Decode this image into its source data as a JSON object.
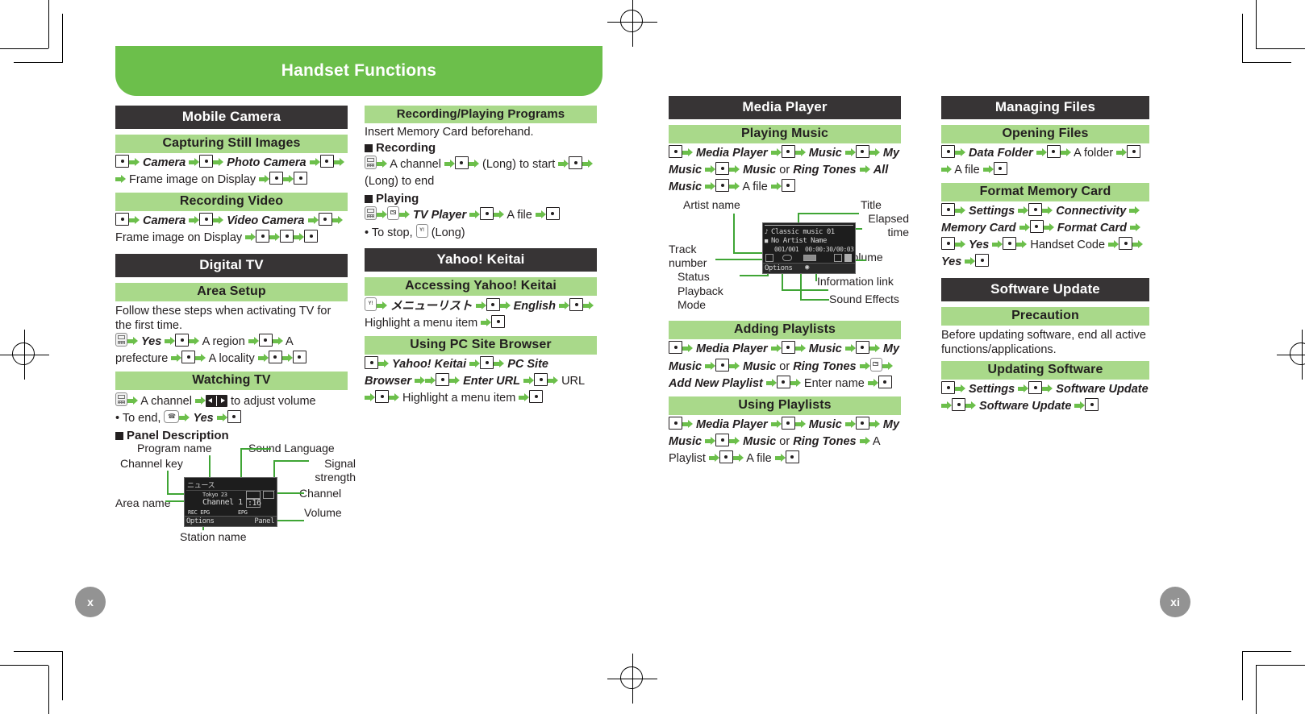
{
  "banner": {
    "title": "Handset Functions"
  },
  "folios": {
    "left": "x",
    "right": "xi"
  },
  "sections": {
    "mobile_camera": {
      "title": "Mobile Camera",
      "capturing": {
        "title": "Capturing Still Images",
        "step_camera": "Camera",
        "step_photo_camera": "Photo Camera",
        "step_frame": "Frame image on Display"
      },
      "recording_video": {
        "title": "Recording Video",
        "step_camera": "Camera",
        "step_video_camera": "Video Camera",
        "step_frame": "Frame image on Display"
      }
    },
    "digital_tv": {
      "title": "Digital TV",
      "area_setup": {
        "title": "Area Setup",
        "intro": "Follow these steps when activating TV for the first time.",
        "step_yes": "Yes",
        "step_region": "A region",
        "step_prefecture": "A prefecture",
        "step_locality": "A locality"
      },
      "watching_tv": {
        "title": "Watching TV",
        "step_channel": "A channel",
        "step_volume": "to adjust volume",
        "bullet_to_end": "• To end,",
        "step_yes": "Yes"
      },
      "panel_description": {
        "title": "Panel Description",
        "labels": {
          "program_name": "Program name",
          "sound_language": "Sound Language",
          "channel_key": "Channel key",
          "signal_strength": "Signal\nstrength",
          "area_name": "Area name",
          "channel": "Channel",
          "volume": "Volume",
          "station_name": "Station name"
        },
        "screen": {
          "program": "ニュース",
          "area": "Tokyo 23",
          "station": "Channel 1",
          "channel_number": ":16",
          "status_row": "REC EPG",
          "softkey_left": "Options",
          "softkey_right": "Panel"
        }
      }
    },
    "recording_playing": {
      "title": "Recording/Playing Programs",
      "intro": "Insert Memory Card beforehand.",
      "recording": {
        "title": "Recording",
        "step_channel": "A channel",
        "long_start": "(Long) to start",
        "long_end": "(Long) to end"
      },
      "playing": {
        "title": "Playing",
        "step_tv_player": "TV Player",
        "step_file": "A file",
        "bullet_stop": "• To stop,",
        "bullet_stop_tail": "(Long)"
      }
    },
    "yahoo_keitai": {
      "title": "Yahoo! Keitai",
      "accessing": {
        "title": "Accessing Yahoo! Keitai",
        "step_menu_list": "メニューリスト",
        "step_english": "English",
        "step_highlight": "Highlight a menu item"
      },
      "pc_site_browser": {
        "title": "Using PC Site Browser",
        "step_yahoo": "Yahoo! Keitai",
        "step_pcsb": "PC Site Browser",
        "step_enter_url": "Enter URL",
        "step_url": "URL",
        "step_highlight": "Highlight a menu item"
      }
    },
    "media_player": {
      "title": "Media Player",
      "playing_music": {
        "title": "Playing Music",
        "step_media_player": "Media Player",
        "step_music": "Music",
        "step_my_music": "My Music",
        "step_music2": "Music",
        "or": "or",
        "step_ring_tones": "Ring Tones",
        "step_all_music": "All Music",
        "step_file": "A file"
      },
      "panel": {
        "labels": {
          "artist_name": "Artist name",
          "title": "Title",
          "elapsed_time": "Elapsed\ntime",
          "track_number": "Track\nnumber",
          "volume": "Volume",
          "status": "Status",
          "information_link": "Information link",
          "playback_mode": "Playback\nMode",
          "sound_effects": "Sound Effects"
        },
        "screen": {
          "track_title": "Classic music 01",
          "artist": "No Artist Name",
          "track_count": "001/001",
          "time": "00:00:30/00:03:00",
          "softkey_left": "Options"
        }
      },
      "adding_playlists": {
        "title": "Adding Playlists",
        "step_media_player": "Media Player",
        "step_music": "Music",
        "step_my_music": "My Music",
        "step_music2": "Music",
        "or": "or",
        "step_ring_tones": "Ring Tones",
        "step_add_new": "Add New Playlist",
        "step_enter_name": "Enter name"
      },
      "using_playlists": {
        "title": "Using Playlists",
        "step_media_player": "Media Player",
        "step_music": "Music",
        "step_my_music": "My Music",
        "step_music2": "Music",
        "or": "or",
        "step_ring_tones": "Ring Tones",
        "step_playlist": "A Playlist",
        "step_file": "A file"
      }
    },
    "managing_files": {
      "title": "Managing Files",
      "opening_files": {
        "title": "Opening Files",
        "step_data_folder": "Data Folder",
        "step_folder": "A folder",
        "step_file": "A file"
      },
      "format_memory_card": {
        "title": "Format Memory Card",
        "step_settings": "Settings",
        "step_connectivity": "Connectivity",
        "step_memory_card": "Memory Card",
        "step_format_card": "Format Card",
        "step_yes": "Yes",
        "step_handset_code": "Handset Code",
        "step_yes2": "Yes"
      }
    },
    "software_update": {
      "title": "Software Update",
      "precaution": {
        "title": "Precaution",
        "body": "Before updating software, end all active functions/applications."
      },
      "updating": {
        "title": "Updating Software",
        "step_settings": "Settings",
        "step_software_update": "Software Update",
        "step_software_update2": "Software Update"
      }
    }
  }
}
